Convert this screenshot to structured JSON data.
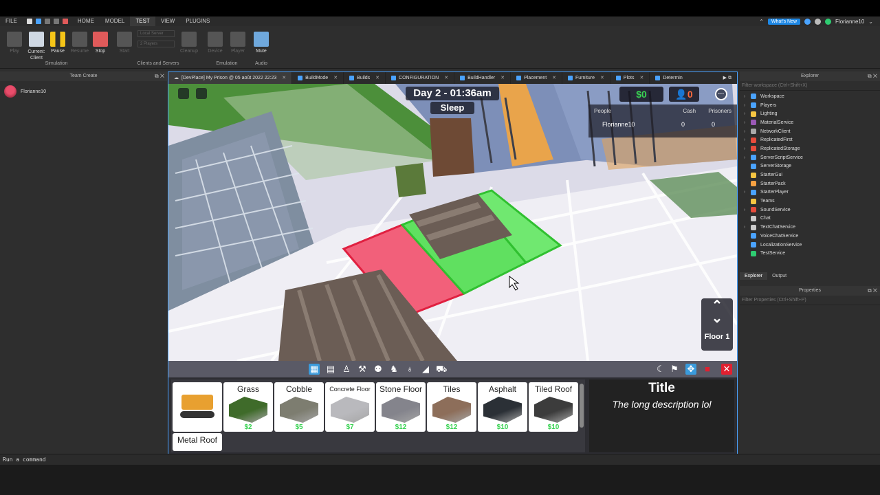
{
  "menu": {
    "file": "FILE",
    "tabs": [
      "HOME",
      "MODEL",
      "TEST",
      "VIEW",
      "PLUGINS"
    ],
    "active_tab": "TEST",
    "whats_new": "What's New",
    "username": "Florianne10"
  },
  "ribbon": {
    "play": "Play",
    "current_client": "Current:\nClient",
    "pause": "Pause",
    "resume": "Resume",
    "stop": "Stop",
    "start": "Start",
    "local_server": "Local Server",
    "players": "2 Players",
    "cleanup": "Cleanup",
    "device": "Device",
    "player": "Player",
    "mute": "Mute",
    "groups": [
      "Simulation",
      "Clients and Servers",
      "Emulation",
      "Audio"
    ]
  },
  "team_create": {
    "title": "Team Create",
    "user": "Florianne10"
  },
  "doc_tabs": [
    {
      "label": "[DevPlace] My Prison @ 05 août 2022 22:23",
      "active": true
    },
    {
      "label": "BuildMode"
    },
    {
      "label": "Builds"
    },
    {
      "label": "CONFIGURATION"
    },
    {
      "label": "BuildHandler"
    },
    {
      "label": "Placement"
    },
    {
      "label": "Furniture"
    },
    {
      "label": "Plots"
    },
    {
      "label": "Determin"
    }
  ],
  "game": {
    "day_clock": "Day 2 - 01:36am",
    "status": "Sleep",
    "cash": "$0",
    "prisoners_count": "0",
    "leaderboard": {
      "headers": [
        "People",
        "Cash",
        "Prisoners"
      ],
      "rows": [
        {
          "name": "Florianne10",
          "cash": "0",
          "prisoners": "0"
        }
      ]
    },
    "floor_label": "Floor 1"
  },
  "build_items": [
    {
      "name": "",
      "price": "",
      "color": "#e8a030",
      "icon": "bulldozer-icon"
    },
    {
      "name": "Grass",
      "price": "$2",
      "color": "#3f6b2a"
    },
    {
      "name": "Cobble",
      "price": "$5",
      "color": "#7d7d70"
    },
    {
      "name": "Concrete Floor",
      "price": "$7",
      "color": "#b9b9bd"
    },
    {
      "name": "Stone Floor",
      "price": "$12",
      "color": "#84848c"
    },
    {
      "name": "Tiles",
      "price": "$12",
      "color": "#8d6e5a"
    },
    {
      "name": "Asphalt",
      "price": "$10",
      "color": "#2b3036"
    },
    {
      "name": "Tiled Roof",
      "price": "$10",
      "color": "#3c3c3c"
    },
    {
      "name": "Metal Roof",
      "price": "",
      "color": "#777"
    }
  ],
  "description": {
    "title": "Title",
    "text": "The long description lol"
  },
  "explorer": {
    "title": "Explorer",
    "filter": "Filter workspace (Ctrl+Shift+X)",
    "items": [
      {
        "label": "Workspace",
        "color": "#4aa3ff",
        "arrow": true
      },
      {
        "label": "Players",
        "color": "#4aa3ff",
        "arrow": true
      },
      {
        "label": "Lighting",
        "color": "#f5c542",
        "arrow": true
      },
      {
        "label": "MaterialService",
        "color": "#9b59b6",
        "arrow": true
      },
      {
        "label": "NetworkClient",
        "color": "#aaaaaa",
        "arrow": true
      },
      {
        "label": "ReplicatedFirst",
        "color": "#e74c3c",
        "arrow": true
      },
      {
        "label": "ReplicatedStorage",
        "color": "#e74c3c",
        "arrow": true
      },
      {
        "label": "ServerScriptService",
        "color": "#4aa3ff",
        "arrow": true
      },
      {
        "label": "ServerStorage",
        "color": "#4aa3ff",
        "arrow": false
      },
      {
        "label": "StarterGui",
        "color": "#f5c542",
        "arrow": false
      },
      {
        "label": "StarterPack",
        "color": "#f5a142",
        "arrow": false
      },
      {
        "label": "StarterPlayer",
        "color": "#4aa3ff",
        "arrow": true
      },
      {
        "label": "Teams",
        "color": "#f5c542",
        "arrow": false
      },
      {
        "label": "SoundService",
        "color": "#e74c3c",
        "arrow": true
      },
      {
        "label": "Chat",
        "color": "#cccccc",
        "arrow": false
      },
      {
        "label": "TextChatService",
        "color": "#cccccc",
        "arrow": true
      },
      {
        "label": "VoiceChatService",
        "color": "#4aa3ff",
        "arrow": false
      },
      {
        "label": "LocalizationService",
        "color": "#4aa3ff",
        "arrow": false
      },
      {
        "label": "TestService",
        "color": "#2ecc71",
        "arrow": false
      }
    ],
    "tabs": [
      "Explorer",
      "Output"
    ]
  },
  "properties": {
    "title": "Properties",
    "filter": "Filter Properties (Ctrl+Shift+P)"
  },
  "command_bar": {
    "placeholder": "Run a command"
  }
}
